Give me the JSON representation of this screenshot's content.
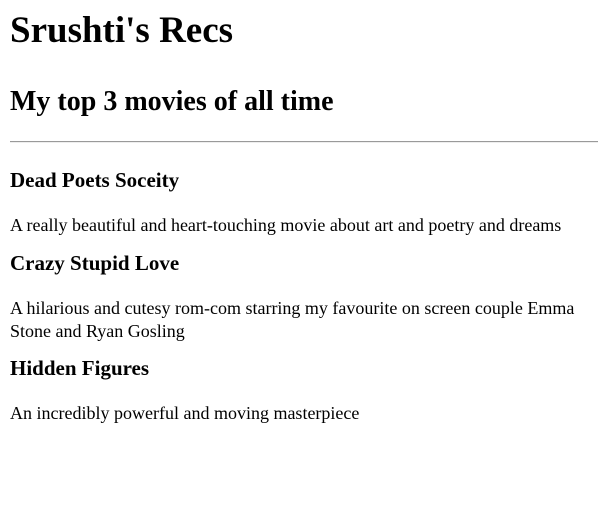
{
  "header": {
    "title": "Srushti's Recs",
    "subtitle": "My top 3 movies of all time"
  },
  "movies": [
    {
      "title": "Dead Poets Soceity",
      "description": "A really beautiful and heart-touching movie about art and poetry and dreams"
    },
    {
      "title": "Crazy Stupid Love",
      "description": "A hilarious and cutesy rom-com starring my favourite on screen couple Emma Stone and Ryan Gosling"
    },
    {
      "title": "Hidden Figures",
      "description": "An incredibly powerful and moving masterpiece"
    }
  ]
}
